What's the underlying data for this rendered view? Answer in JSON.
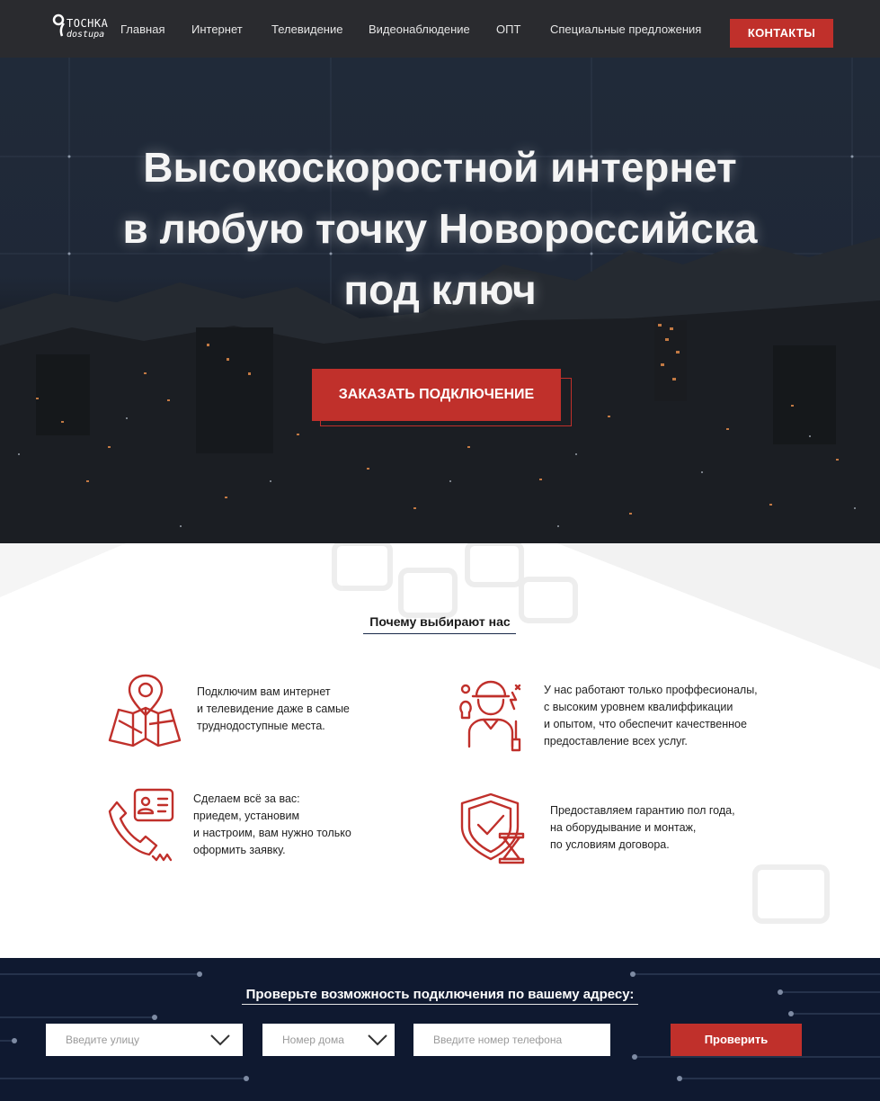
{
  "brand": {
    "logo_top": "TOCHKA",
    "logo_bottom": "dostupa",
    "accent_color": "#c0302b",
    "nav_bg": "#2a2b2f",
    "footer_bg": "#0f1930"
  },
  "nav": {
    "items": [
      {
        "label": "Главная"
      },
      {
        "label": "Интернет"
      },
      {
        "label": "Телевидение"
      },
      {
        "label": "Видеонаблюдение"
      },
      {
        "label": "ОПТ"
      },
      {
        "label": "Специальные предложения"
      }
    ],
    "contacts_label": "КОНТАКТЫ"
  },
  "hero": {
    "title_lines": [
      "Высокоскоростной интернет",
      "в любую точку Новороссийска",
      "под ключ"
    ],
    "order_label": "ЗАКАЗАТЬ ПОДКЛЮЧЕНИЕ"
  },
  "why": {
    "title": "Почему выбирают нас",
    "features": [
      {
        "icon": "map-pin-icon",
        "lines": [
          "Подключим вам интернет",
          "и телевидение даже в самые",
          "труднодоступные места."
        ]
      },
      {
        "icon": "professional-worker-icon",
        "lines": [
          "У нас работают только проффесионалы,",
          "с высоким уровнем квалиффикации",
          "и опытом, что обеспечит качественное",
          "предоставление всех услуг."
        ]
      },
      {
        "icon": "phone-contact-icon",
        "lines": [
          "Сделаем всё за вас:",
          "приедем, установим",
          "и настроим, вам нужно только",
          "оформить заявку."
        ]
      },
      {
        "icon": "shield-hourglass-icon",
        "lines": [
          "Предоставляем гарантию пол года,",
          "на оборудывание и монтаж,",
          "по условиям договора."
        ]
      }
    ]
  },
  "check": {
    "title": "Проверьте возможность подключения по вашему адресу:",
    "street_placeholder": "Введите улицу",
    "house_placeholder": "Номер дома",
    "phone_placeholder": "Введите номер телефона",
    "submit_label": "Проверить"
  }
}
